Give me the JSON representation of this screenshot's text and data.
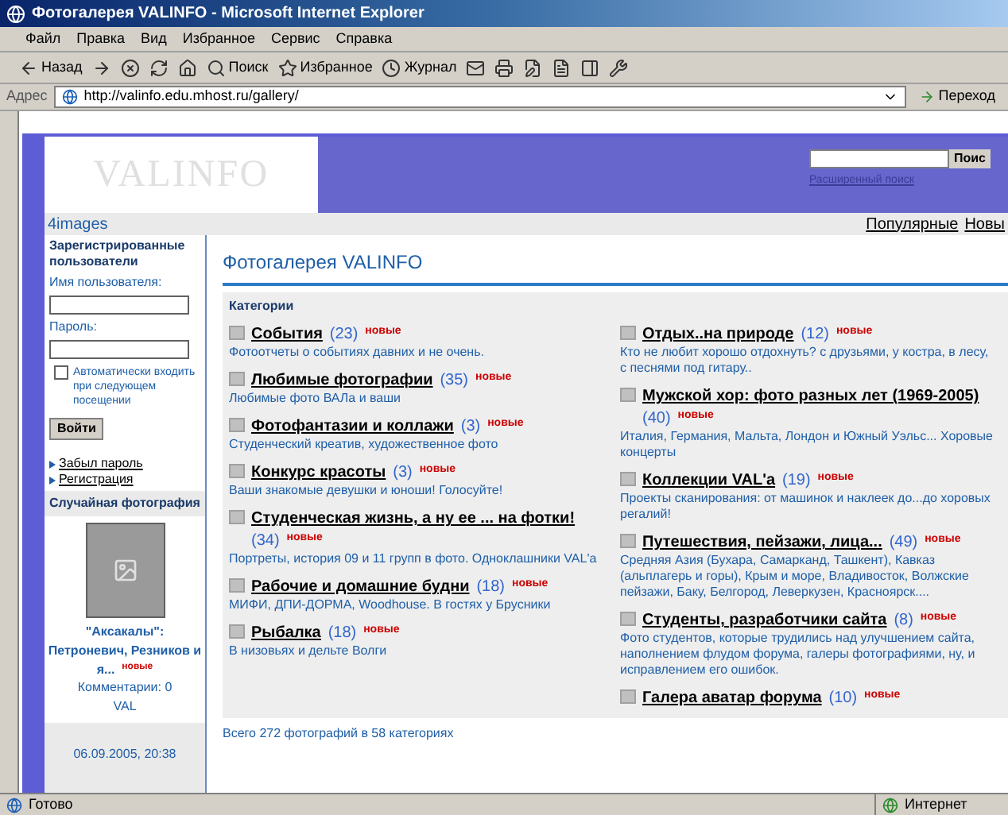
{
  "window": {
    "title": "Фотогалерея VALINFO - Microsoft Internet Explorer"
  },
  "menu": [
    "Файл",
    "Правка",
    "Вид",
    "Избранное",
    "Сервис",
    "Справка"
  ],
  "toolbar": [
    {
      "kind": "back",
      "label": "Назад"
    },
    {
      "kind": "forward"
    },
    {
      "kind": "stop"
    },
    {
      "kind": "refresh"
    },
    {
      "kind": "home"
    },
    {
      "kind": "search",
      "label": "Поиск"
    },
    {
      "kind": "favorites",
      "label": "Избранное"
    },
    {
      "kind": "history",
      "label": "Журнал"
    },
    {
      "kind": "mail"
    },
    {
      "kind": "print"
    },
    {
      "kind": "edit"
    },
    {
      "kind": "doc"
    },
    {
      "kind": "window"
    },
    {
      "kind": "tools"
    }
  ],
  "address": {
    "label": "Адрес",
    "url": "http://valinfo.edu.mhost.ru/gallery/",
    "go": "Переход"
  },
  "header": {
    "logo": "VALINFO",
    "search_button": "Поис",
    "advanced_search": "Расширенный поиск"
  },
  "brand": "4images",
  "nav_links": [
    "Популярные",
    "Новы"
  ],
  "sidebar": {
    "login_title": "Зарегистрированные пользователи",
    "username_label": "Имя пользователя:",
    "password_label": "Пароль:",
    "auto_login": {
      "label": "Автоматически входить при следующем посещении",
      "checked": false
    },
    "login_button": "Войти",
    "links": [
      "Забыл пароль",
      "Регистрация"
    ],
    "random_title": "Случайная фотография",
    "photo_caption": "\"Аксакалы\": Петроневич, Резников и я...",
    "photo_badge": "новые",
    "comments": "Комментарии: 0",
    "author": "VAL",
    "date": "06.09.2005, 20:38"
  },
  "main": {
    "title": "Фотогалерея VALINFO",
    "categories_heading": "Категории",
    "columns": [
      [
        {
          "name": "События",
          "count": "(23)",
          "badge": "новые",
          "description": "Фотоотчеты о событиях давних и не очень."
        },
        {
          "name": "Любимые фотографии",
          "count": "(35)",
          "badge": "новые",
          "description": "Любимые фото ВАЛа и ваши"
        },
        {
          "name": "Фотофантазии и коллажи",
          "count": "(3)",
          "badge": "новые",
          "description": "Студенческий креатив, художественное фото"
        },
        {
          "name": "Конкурс красоты",
          "count": "(3)",
          "badge": "новые",
          "description": "Ваши знакомые девушки и юноши! Голосуйте!"
        },
        {
          "name": "Студенческая жизнь, а ну ее ... на фотки!",
          "count": "(34)",
          "badge": "новые",
          "description": "Портреты, история 09 и 11 групп в фото. Одноклашники VAL'a"
        },
        {
          "name": "Рабочие и домашние будни",
          "count": "(18)",
          "badge": "новые",
          "description": "МИФИ, ДПИ-ДОРМА, Woodhouse. В гостях у Брусники"
        },
        {
          "name": "Рыбалка",
          "count": "(18)",
          "badge": "новые",
          "description": "В низовьях и дельте Волги"
        }
      ],
      [
        {
          "name": "Отдых..на природе",
          "count": "(12)",
          "badge": "новые",
          "description": "Кто не любит хорошо отдохнуть? с друзьями, у костра, в лесу, с песнями под гитару.."
        },
        {
          "name": "Мужской хор: фото разных лет (1969-2005)",
          "count": "(40)",
          "badge": "новые",
          "description": "Италия, Германия, Мальта, Лондон и Южный Уэльс... Хоровые концерты"
        },
        {
          "name": "Коллекции VAL'a",
          "count": "(19)",
          "badge": "новые",
          "description": "Проекты сканирования: от машинок и наклеек до...до хоровых регалий!"
        },
        {
          "name": "Путешествия, пейзажи, лица...",
          "count": "(49)",
          "badge": "новые",
          "description": "Средняя Азия (Бухара, Самарканд, Ташкент), Кавказ (альплагерь и горы), Крым и море, Владивосток, Волжские пейзажи, Баку, Белгород, Леверкузен, Красноярск...."
        },
        {
          "name": "Студенты, разработчики сайта",
          "count": "(8)",
          "badge": "новые",
          "description": "Фото студентов, которые трудились над улучшением сайта, наполнением флудом форума, галеры фотографиями, ну, и исправлением его ошибок."
        },
        {
          "name": "Галера аватар форума",
          "count": "(10)",
          "badge": "новые"
        }
      ]
    ],
    "total": "Всего 272 фотографий в 58 категориях"
  },
  "status_bar": {
    "text": "Готово",
    "zone": "Интернет"
  }
}
